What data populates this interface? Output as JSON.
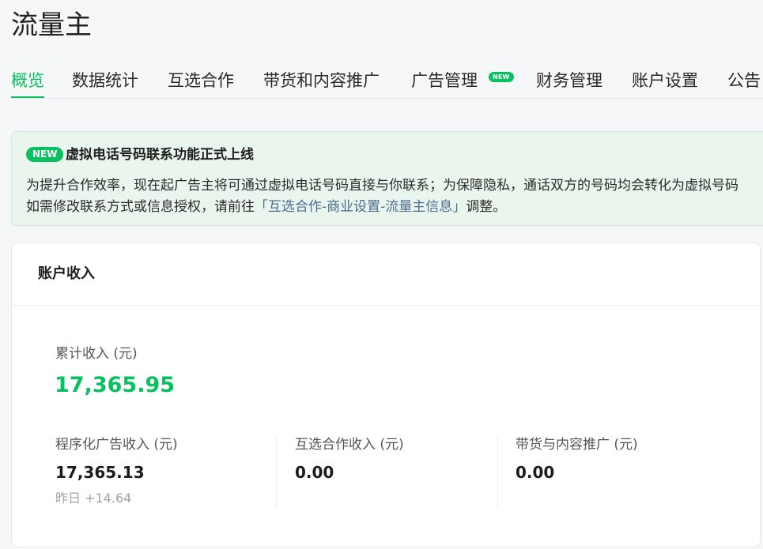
{
  "app": {
    "title": "流量主"
  },
  "tabs": [
    {
      "label": "概览",
      "active": true
    },
    {
      "label": "数据统计"
    },
    {
      "label": "互选合作"
    },
    {
      "label": "带货和内容推广"
    },
    {
      "label": "广告管理",
      "badge": "NEW"
    },
    {
      "label": "财务管理"
    },
    {
      "label": "账户设置"
    },
    {
      "label": "公告"
    }
  ],
  "notice": {
    "badge": "NEW",
    "title": "虚拟电话号码联系功能正式上线",
    "line1": "为提升合作效率，现在起广告主将可通过虚拟电话号码直接与你联系；为保障隐私，通话双方的号码均会转化为虚拟号码",
    "line2_prefix": "如需修改联系方式或信息授权，请前往",
    "line2_link": "「互选合作-商业设置-流量主信息」",
    "line2_suffix": "调整。"
  },
  "income": {
    "title": "账户收入",
    "total_label": "累计收入 (元)",
    "total_value": "17,365.95",
    "items": [
      {
        "label": "程序化广告收入 (元)",
        "value": "17,365.13",
        "sub": "昨日 +14.64"
      },
      {
        "label": "互选合作收入 (元)",
        "value": "0.00"
      },
      {
        "label": "带货与内容推广 (元)",
        "value": "0.00"
      }
    ]
  },
  "colors": {
    "accent": "#07c160",
    "link": "#4d6a8f",
    "notice_bg": "#eaf5ee",
    "page_bg": "#f6f7f9"
  }
}
